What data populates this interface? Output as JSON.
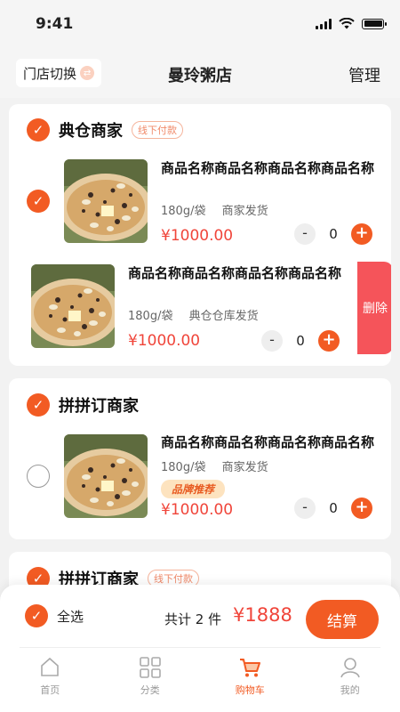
{
  "status": {
    "time": "9:41"
  },
  "header": {
    "store_switch": "门店切换",
    "title": "曼玲粥店",
    "manage": "管理"
  },
  "shops": [
    {
      "name": "典仓商家",
      "tag": "线下付款",
      "items": [
        {
          "title": "商品名称商品名称商品名称商品名称",
          "spec": "180g/袋",
          "ship": "商家发货",
          "price": "¥1000.00",
          "qty": "0"
        },
        {
          "title": "商品名称商品名称商品名称商品名称",
          "spec": "180g/袋",
          "ship": "典仓仓库发货",
          "price": "¥1000.00",
          "qty": "0",
          "delete": "删除"
        }
      ]
    },
    {
      "name": "拼拼订商家",
      "items": [
        {
          "title": "商品名称商品名称商品名称商品名称",
          "spec": "180g/袋",
          "ship": "商家发货",
          "brand": "品牌推荐",
          "price": "¥1000.00",
          "qty": "0"
        }
      ]
    },
    {
      "name": "拼拼订商家",
      "tag": "线下付款"
    }
  ],
  "footer": {
    "select_all": "全选",
    "total_label": "共计 2 件",
    "total_price": "¥1888",
    "checkout": "结算"
  },
  "tabbar": [
    {
      "label": "首页",
      "icon": "home-icon"
    },
    {
      "label": "分类",
      "icon": "category-icon"
    },
    {
      "label": "购物车",
      "icon": "cart-icon"
    },
    {
      "label": "我的",
      "icon": "profile-icon"
    }
  ],
  "colors": {
    "accent": "#f25b23",
    "price": "#f0453a",
    "delete": "#f5545a"
  }
}
